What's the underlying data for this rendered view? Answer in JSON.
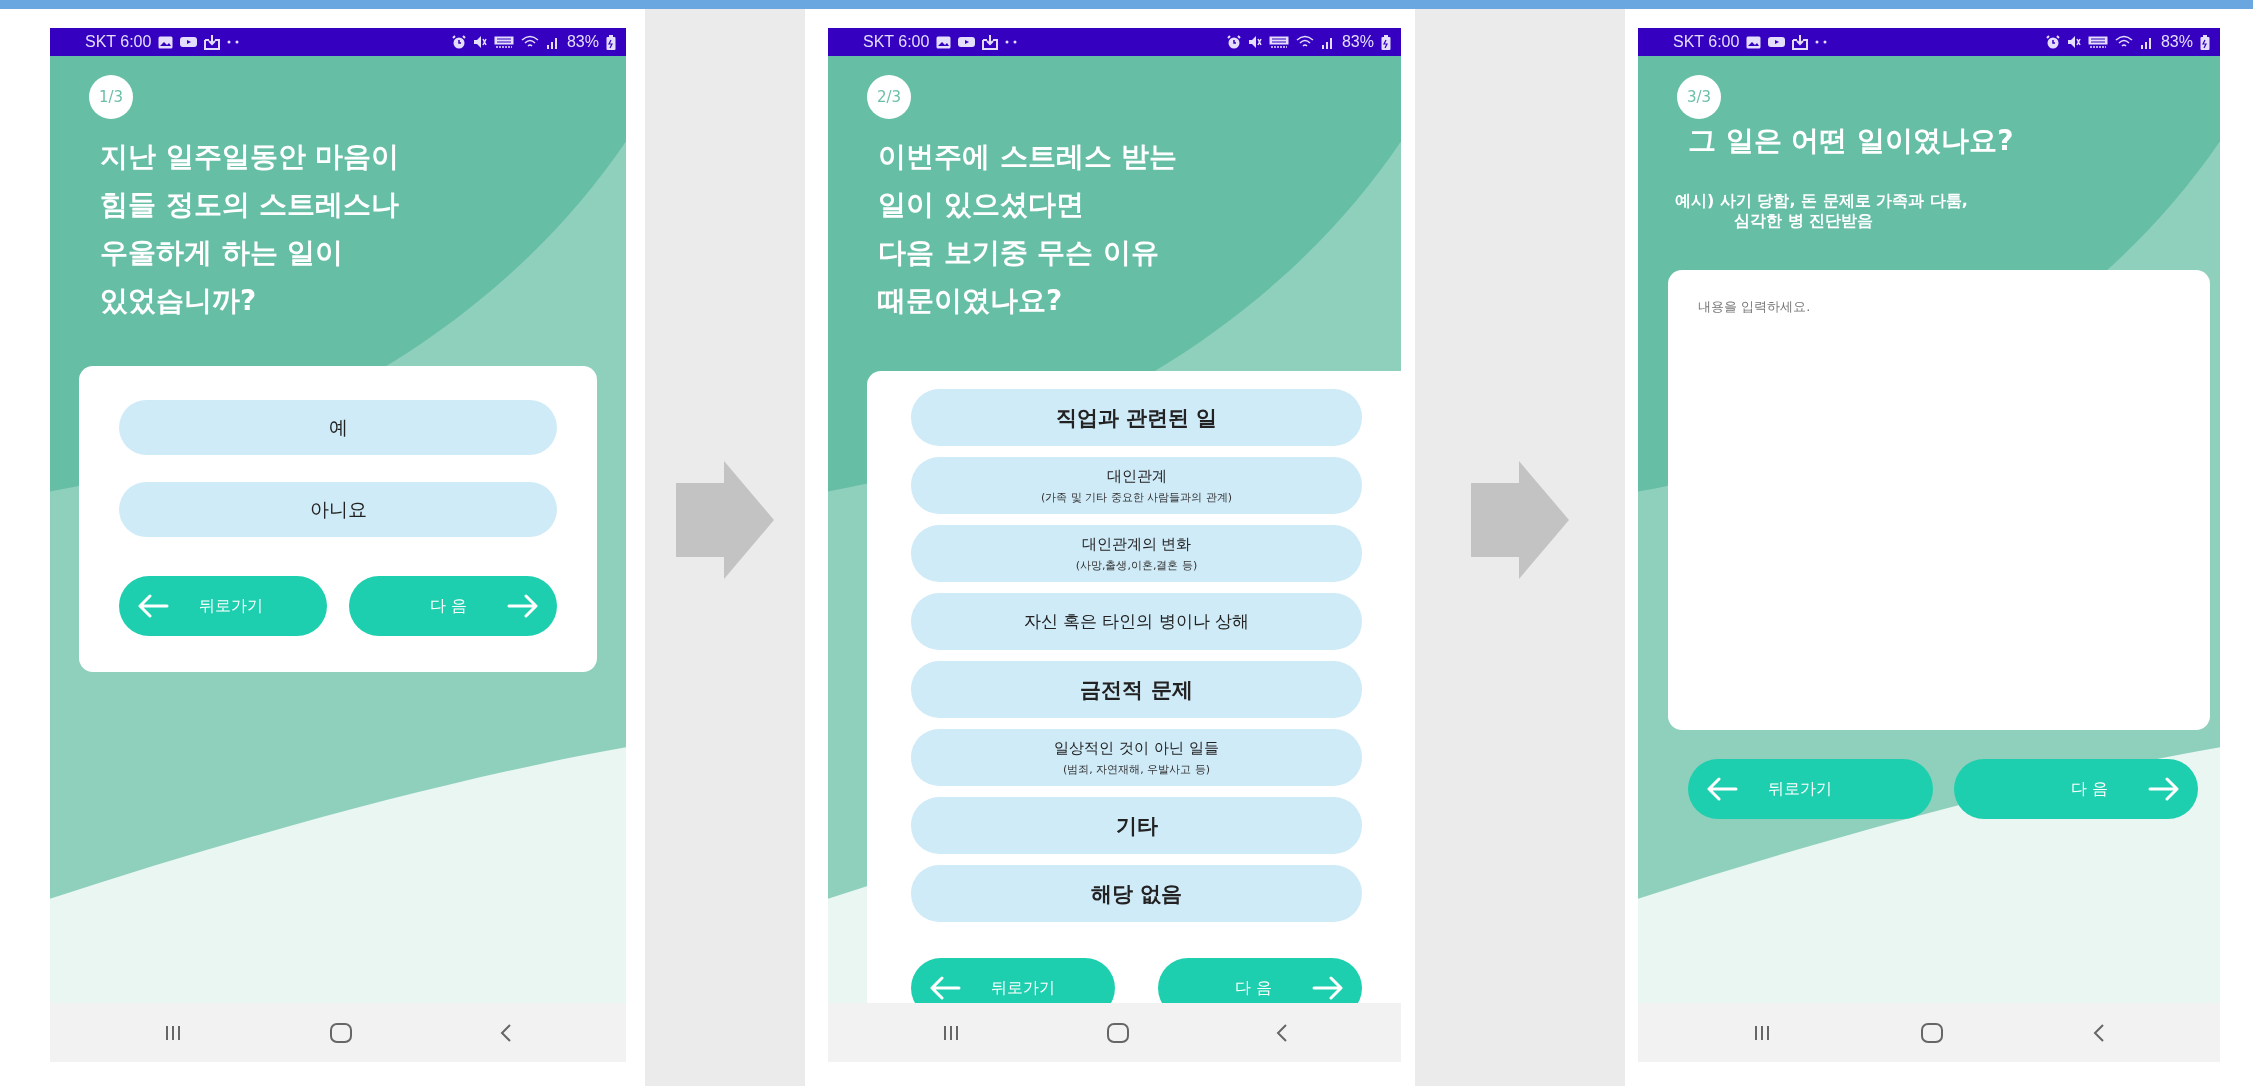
{
  "screens": [
    {
      "status_bar": {
        "text": "SKT 6:00",
        "battery": "83%"
      },
      "step": "1/3",
      "kind": "choice",
      "question": "지난 일주일동안 마음이\n힘들 정도의 스트레스나\n우울하게 하는 일이\n있었습니까?",
      "options": [
        {
          "label": "예",
          "emphasis": false
        },
        {
          "label": "아니요",
          "emphasis": false
        }
      ],
      "back_button": "뒤로가기",
      "next_button": "다 음"
    },
    {
      "status_bar": {
        "text": "SKT 6:00",
        "battery": "83%"
      },
      "step": "2/3",
      "kind": "choice",
      "question": "이번주에 스트레스 받는\n일이 있으셨다면\n다음 보기중 무슨 이유\n때문이였나요?",
      "options": [
        {
          "label": "직업과 관련된 일",
          "emphasis": true
        },
        {
          "label": "대인관계",
          "detail": "(가족 및 기타 중요한 사람들과의 관계)",
          "emphasis": false
        },
        {
          "label": "대인관계의 변화",
          "detail": "(사망,출생,이혼,결혼 등)",
          "emphasis": false
        },
        {
          "label": "자신 혹은 타인의 병이나 상해",
          "emphasis": false
        },
        {
          "label": "금전적 문제",
          "emphasis": true
        },
        {
          "label": "일상적인 것이 아닌 일들",
          "detail": "(범죄, 자연재해, 우발사고 등)",
          "emphasis": false
        },
        {
          "label": "기타",
          "emphasis": true
        },
        {
          "label": "해당 없음",
          "emphasis": true
        }
      ],
      "back_button": "뒤로가기",
      "next_button": "다 음"
    },
    {
      "status_bar": {
        "text": "SKT 6:00",
        "battery": "83%"
      },
      "step": "3/3",
      "kind": "text",
      "question": "그 일은 어떤 일이였나요?",
      "hint": "예시) 사기 당함, 돈 문제로 가족과 다툼,\n심각한 병 진단받음",
      "answer": {
        "placeholder": "내용을 입력하세요."
      },
      "back_button": "뒤로가기",
      "next_button": "다 음"
    }
  ]
}
